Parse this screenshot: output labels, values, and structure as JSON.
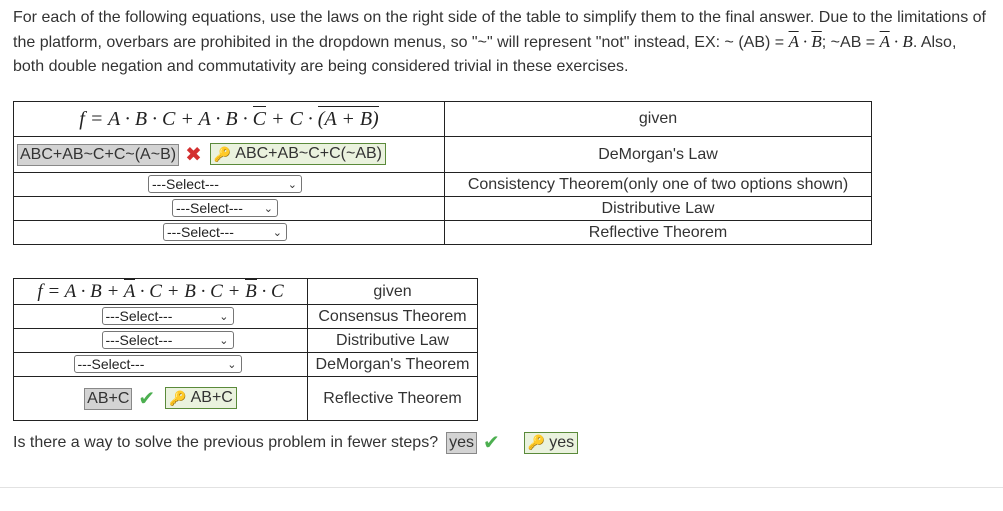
{
  "intro": {
    "p1": "For each of the following equations, use the laws on the right side of the table to simplify them to the final answer. Due to the limitations of the platform, overbars are prohibited in the dropdown menus, so \"~\" will represent \"not\" instead, EX: ~ (AB) = ",
    "ex1_lhs_bar_a": "A",
    "ex1_dot": " · ",
    "ex1_lhs_bar_b": "B",
    "p2": "; ~AB = ",
    "ex2_bar_a": "A",
    "ex2_rest": " · B",
    "p3": ". Also, both double negation and commutativity are being considered trivial in these exercises."
  },
  "table1": {
    "formula_parts": [
      "f = A · B · C + A · B · ",
      "C",
      " + C · ",
      "(A + ",
      "B",
      ")"
    ],
    "rows": [
      {
        "law": "given"
      },
      {
        "answer": "ABC+AB~C+C~(A~B)",
        "correct": "ABC+AB~C+C(~AB)",
        "law": "DeMorgan's Law"
      },
      {
        "select": "---Select---",
        "law": "Consistency Theorem(only one of two options shown)"
      },
      {
        "select": "---Select---",
        "law": "Distributive Law"
      },
      {
        "select": "---Select---",
        "law": "Reflective Theorem"
      }
    ]
  },
  "table2": {
    "formula_parts": [
      "f = A · B + ",
      "A",
      " · C + B · C + ",
      "B",
      " · C"
    ],
    "rows": [
      {
        "law": "given"
      },
      {
        "select": "---Select---",
        "law": "Consensus Theorem"
      },
      {
        "select": "---Select---",
        "law": "Distributive Law"
      },
      {
        "select": "---Select---",
        "law": "DeMorgan's Theorem"
      },
      {
        "answer": "AB+C",
        "correct": "AB+C",
        "law": "Reflective Theorem"
      }
    ]
  },
  "question": {
    "text": "Is there a way to solve the previous problem in fewer steps?",
    "answer": "yes",
    "correct": "yes"
  },
  "colors": {
    "incorrect": "#d32f2f",
    "correct": "#4caf50",
    "key": "#d9a520"
  },
  "icons": {
    "incorrect": "x-icon",
    "correct": "check-icon",
    "key": "key-icon",
    "dropdown": "chevron-down-icon"
  }
}
